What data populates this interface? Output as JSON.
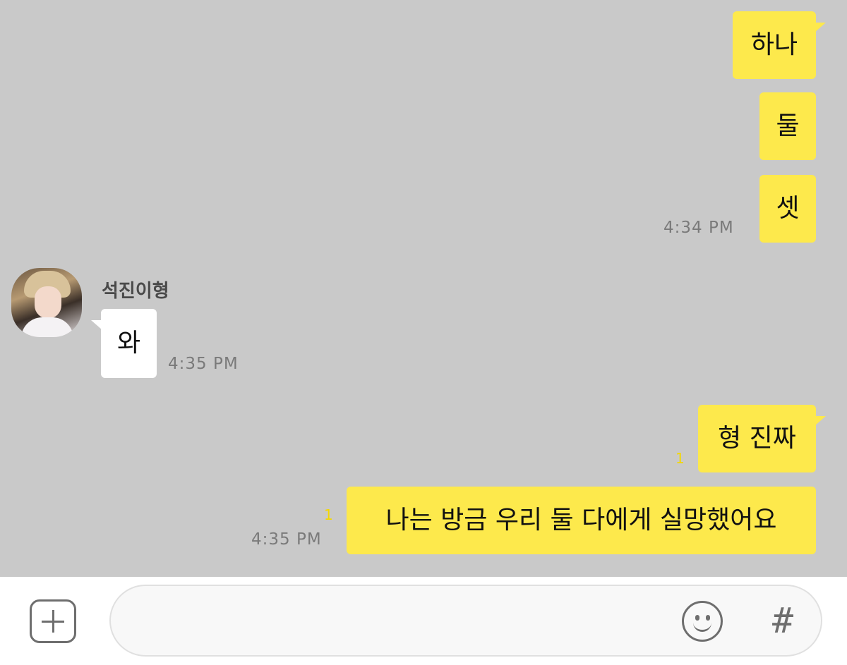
{
  "messages": {
    "m1": "하나",
    "m2": "둘",
    "m3": "셋",
    "m3_time": "4:34 PM",
    "sender_name": "석진이형",
    "r1": "와",
    "r1_time": "4:35 PM",
    "m4": "형 진짜",
    "m4_unread": "1",
    "m5": "나는 방금 우리 둘 다에게 실망했어요",
    "m5_unread": "1",
    "m5_time": "4:35 PM"
  },
  "input_bar": {
    "text": "",
    "plus_icon": "plus-square-icon",
    "emoji_icon": "smiley-icon",
    "hash_icon": "hash-icon",
    "hash_glyph": "#"
  },
  "colors": {
    "background": "#c9c9c9",
    "my_bubble": "#fde94c",
    "their_bubble": "#ffffff",
    "timestamp": "#7a7a7a",
    "unread_count": "#f4d800"
  }
}
